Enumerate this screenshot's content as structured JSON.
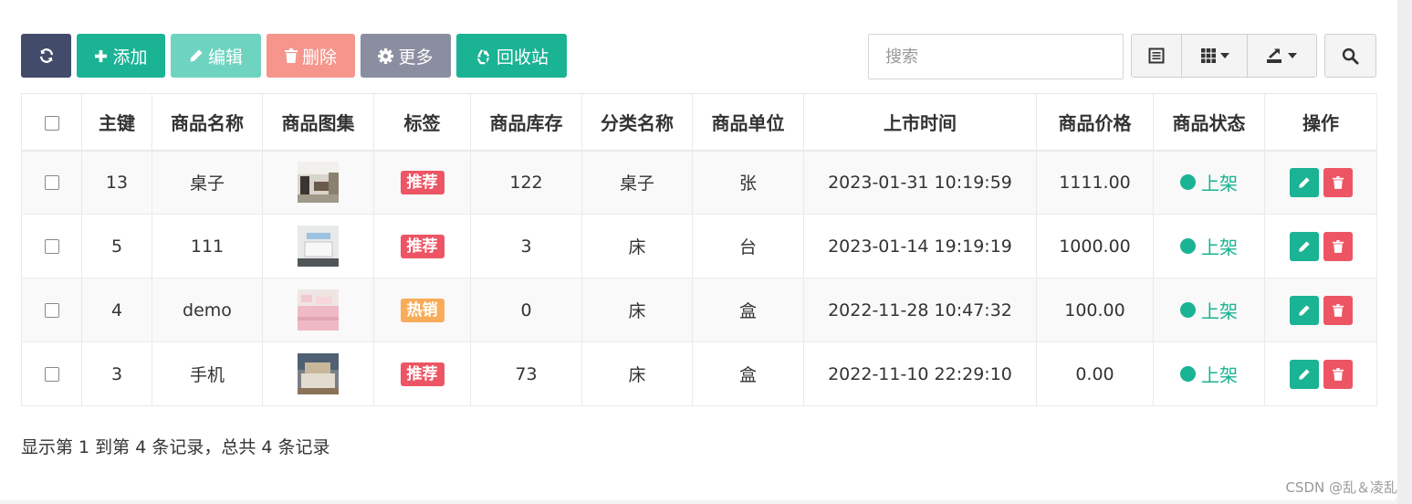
{
  "toolbar": {
    "refresh_icon": "refresh-icon",
    "add_label": "添加",
    "edit_label": "编辑",
    "delete_label": "删除",
    "more_label": "更多",
    "recycle_label": "回收站",
    "colors": {
      "refresh": "#424b69",
      "add": "#1ab394",
      "edit": "#6fd4bf",
      "delete": "#f5958c",
      "more": "#8a8ea0",
      "recycle": "#1ab394"
    }
  },
  "search": {
    "placeholder": "搜索",
    "value": ""
  },
  "table": {
    "columns": [
      "主键",
      "商品名称",
      "商品图集",
      "标签",
      "商品库存",
      "分类名称",
      "商品单位",
      "上市时间",
      "商品价格",
      "商品状态",
      "操作"
    ],
    "rows": [
      {
        "id": "13",
        "name": "桌子",
        "tag": "推荐",
        "tag_color": "red",
        "stock": "122",
        "category": "桌子",
        "unit": "张",
        "time": "2023-01-31 10:19:59",
        "price": "1111.00",
        "status": "上架"
      },
      {
        "id": "5",
        "name": "111",
        "tag": "推荐",
        "tag_color": "red",
        "stock": "3",
        "category": "床",
        "unit": "台",
        "time": "2023-01-14 19:19:19",
        "price": "1000.00",
        "status": "上架"
      },
      {
        "id": "4",
        "name": "demo",
        "tag": "热销",
        "tag_color": "orange",
        "stock": "0",
        "category": "床",
        "unit": "盒",
        "time": "2022-11-28 10:47:32",
        "price": "100.00",
        "status": "上架"
      },
      {
        "id": "3",
        "name": "手机",
        "tag": "推荐",
        "tag_color": "red",
        "stock": "73",
        "category": "床",
        "unit": "盒",
        "time": "2022-11-10 22:29:10",
        "price": "0.00",
        "status": "上架"
      }
    ]
  },
  "pagination": {
    "info": "显示第 1 到第 4 条记录，总共 4 条记录"
  },
  "watermark": "CSDN @乱＆凌乱"
}
